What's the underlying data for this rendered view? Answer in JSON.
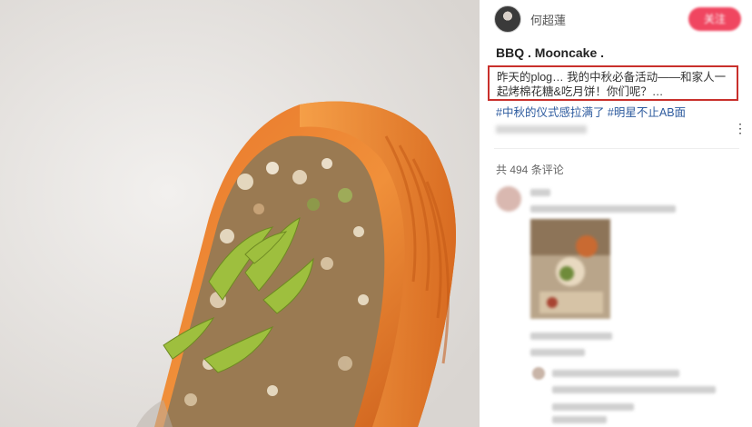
{
  "post": {
    "author_name": "何超蓮",
    "follow_label": "关注",
    "title": "BBQ . Mooncake .",
    "body": "昨天的plog… 我的中秋必备活动——和家人一起烤棉花糖&吃月饼！你们呢？…",
    "hashtags": "#中秋的仪式感拉满了 #明星不止AB面",
    "more_icon": "more-horizontal-icon"
  },
  "comments": {
    "count_label": "共 494 条评论"
  },
  "photo": {
    "subject": "mooncake-with-nut-filling-photo"
  }
}
